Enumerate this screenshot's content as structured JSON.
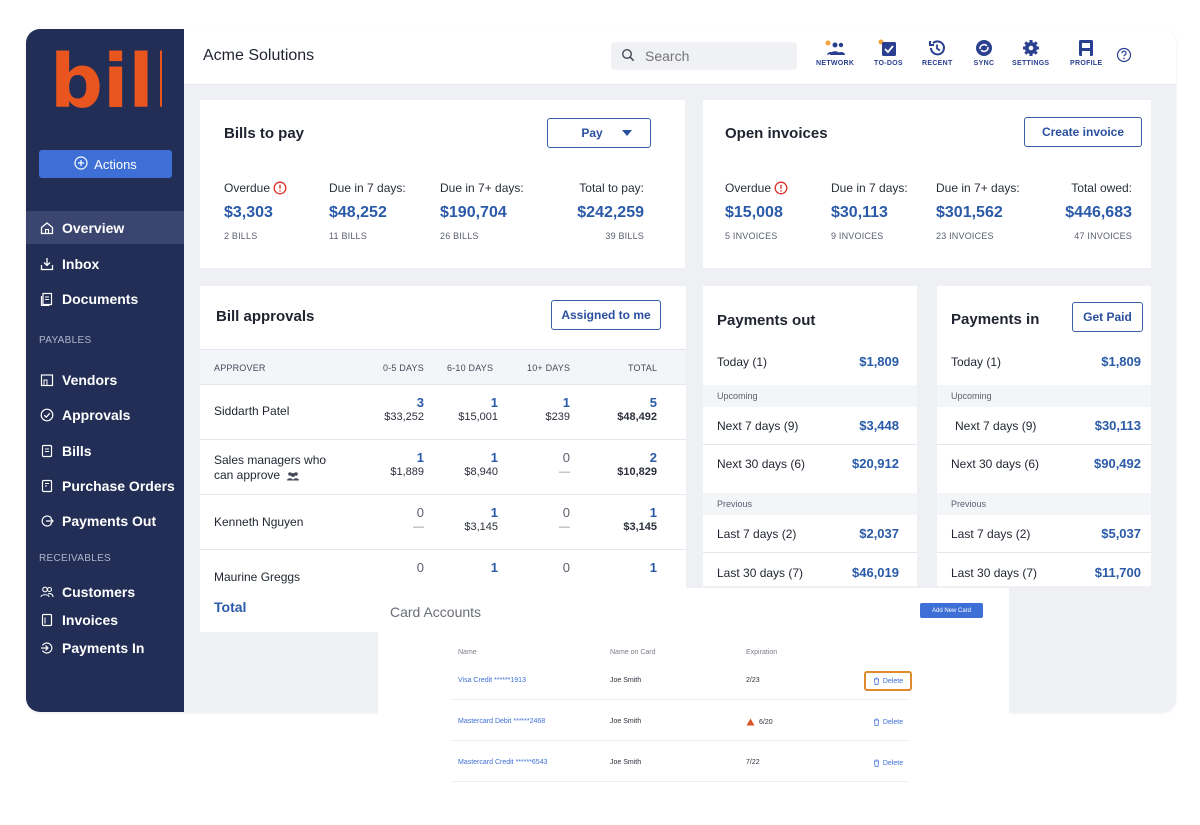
{
  "brand": {
    "logo_text": "bill"
  },
  "sidebar": {
    "actions_label": "Actions",
    "items_top": [
      {
        "label": "Overview",
        "icon": "home-icon"
      },
      {
        "label": "Inbox",
        "icon": "inbox-icon"
      },
      {
        "label": "Documents",
        "icon": "documents-icon"
      }
    ],
    "payables_label": "PAYABLES",
    "items_payables": [
      {
        "label": "Vendors",
        "icon": "vendors-icon"
      },
      {
        "label": "Approvals",
        "icon": "approvals-icon"
      },
      {
        "label": "Bills",
        "icon": "bills-icon"
      },
      {
        "label": "Purchase Orders",
        "icon": "purchase-orders-icon"
      },
      {
        "label": "Payments Out",
        "icon": "payments-out-icon"
      }
    ],
    "receivables_label": "RECEIVABLES",
    "items_receivables": [
      {
        "label": "Customers",
        "icon": "customers-icon"
      },
      {
        "label": "Invoices",
        "icon": "invoices-icon"
      },
      {
        "label": "Payments In",
        "icon": "payments-in-icon"
      }
    ]
  },
  "header": {
    "company": "Acme Solutions",
    "search_placeholder": "Search",
    "icons": [
      {
        "label": "NETWORK"
      },
      {
        "label": "TO-DOS"
      },
      {
        "label": "RECENT"
      },
      {
        "label": "SYNC"
      },
      {
        "label": "SETTINGS"
      },
      {
        "label": "PROFILE"
      }
    ]
  },
  "bills_to_pay": {
    "title": "Bills to pay",
    "button": "Pay",
    "stats": [
      {
        "label": "Overdue",
        "amount": "$3,303",
        "count": "2 BILLS"
      },
      {
        "label": "Due in 7 days:",
        "amount": "$48,252",
        "count": "11 BILLS"
      },
      {
        "label": "Due in 7+ days:",
        "amount": "$190,704",
        "count": "26 BILLS"
      },
      {
        "label": "Total to pay:",
        "amount": "$242,259",
        "count": "39 BILLS"
      }
    ]
  },
  "open_invoices": {
    "title": "Open invoices",
    "button": "Create invoice",
    "stats": [
      {
        "label": "Overdue",
        "amount": "$15,008",
        "count": "5 INVOICES"
      },
      {
        "label": "Due in 7 days:",
        "amount": "$30,113",
        "count": "9 INVOICES"
      },
      {
        "label": "Due in 7+ days:",
        "amount": "$301,562",
        "count": "23 INVOICES"
      },
      {
        "label": "Total owed:",
        "amount": "$446,683",
        "count": "47 INVOICES"
      }
    ]
  },
  "bill_approvals": {
    "title": "Bill approvals",
    "button": "Assigned to me",
    "columns": [
      "APPROVER",
      "0-5 DAYS",
      "6-10 DAYS",
      "10+ DAYS",
      "TOTAL"
    ],
    "rows": [
      {
        "name": "Siddarth Patel",
        "c1n": "3",
        "c1v": "$33,252",
        "c2n": "1",
        "c2v": "$15,001",
        "c3n": "1",
        "c3v": "$239",
        "tn": "5",
        "tv": "$48,492"
      },
      {
        "name": "Sales managers who",
        "name2": "can approve",
        "c1n": "1",
        "c1v": "$1,889",
        "c2n": "1",
        "c2v": "$8,940",
        "c3n": "0",
        "c3v": "—",
        "tn": "2",
        "tv": "$10,829"
      },
      {
        "name": "Kenneth Nguyen",
        "c1n": "0",
        "c1v": "—",
        "c2n": "1",
        "c2v": "$3,145",
        "c3n": "0",
        "c3v": "—",
        "tn": "1",
        "tv": "$3,145"
      },
      {
        "name": "Maurine Greggs",
        "c1n": "0",
        "c1v": "",
        "c2n": "1",
        "c2v": "",
        "c3n": "0",
        "c3v": "",
        "tn": "1",
        "tv": ""
      }
    ],
    "total_label": "Total"
  },
  "payments_out": {
    "title": "Payments out",
    "today_label": "Today (1)",
    "today_amount": "$1,809",
    "upcoming_label": "Upcoming",
    "next7_label": "Next 7 days (9)",
    "next7_amount": "$3,448",
    "next30_label": "Next 30 days (6)",
    "next30_amount": "$20,912",
    "previous_label": "Previous",
    "last7_label": "Last 7 days (2)",
    "last7_amount": "$2,037",
    "last30_label": "Last  30 days (7)",
    "last30_amount": "$46,019"
  },
  "payments_in": {
    "title": "Payments in",
    "button": "Get Paid",
    "today_label": "Today (1)",
    "today_amount": "$1,809",
    "upcoming_label": "Upcoming",
    "next7_label": "Next 7 days (9)",
    "next7_amount": "$30,113",
    "next30_label": "Next 30 days (6)",
    "next30_amount": "$90,492",
    "previous_label": "Previous",
    "last7_label": "Last 7 days (2)",
    "last7_amount": "$5,037",
    "last30_label": "Last  30 days (7)",
    "last30_amount": "$11,700"
  },
  "card_accounts": {
    "title": "Card Accounts",
    "add_button": "Add New Card",
    "columns": [
      "Name",
      "Name on Card",
      "Expiration"
    ],
    "rows": [
      {
        "name": "Visa Credit ******1913",
        "holder": "Joe Smith",
        "exp": "2/23",
        "warn": false,
        "action": "Delete"
      },
      {
        "name": "Mastercard Debit ******2468",
        "holder": "Joe Smith",
        "exp": "6/20",
        "warn": true,
        "action": "Delete"
      },
      {
        "name": "Mastercard Credit ******6543",
        "holder": "Joe Smith",
        "exp": "7/22",
        "warn": false,
        "action": "Delete"
      }
    ]
  },
  "colors": {
    "sidebar": "#222e55",
    "accent": "#3d6fd6",
    "brand_orange": "#e8551e",
    "link": "#2a5aa8",
    "highlight": "#e08a2e"
  }
}
